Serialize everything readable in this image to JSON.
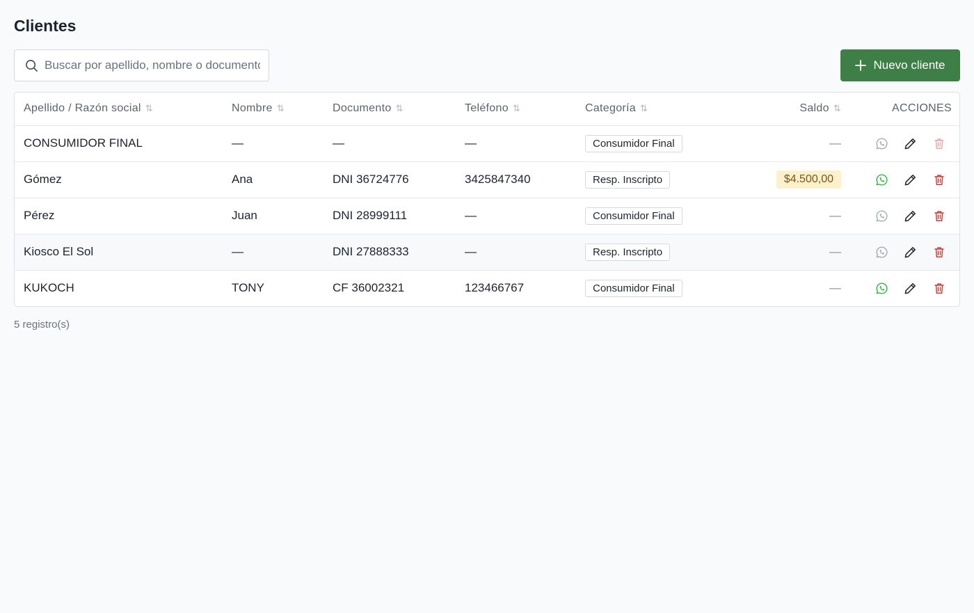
{
  "page": {
    "title": "Clientes"
  },
  "search": {
    "placeholder": "Buscar por apellido, nombre o documento",
    "value": ""
  },
  "new_button": {
    "label": "Nuevo cliente"
  },
  "table": {
    "headers": {
      "apellido": "Apellido / Razón social",
      "nombre": "Nombre",
      "documento": "Documento",
      "telefono": "Teléfono",
      "categoria": "Categoría",
      "saldo": "Saldo",
      "acciones": "ACCIONES"
    },
    "sort_glyph": "⇅",
    "rows": [
      {
        "apellido": "CONSUMIDOR FINAL",
        "nombre": "—",
        "documento": "—",
        "telefono": "—",
        "categoria": "Consumidor Final",
        "saldo": "—"
      },
      {
        "apellido": "Gómez",
        "nombre": "Ana",
        "documento": "DNI 36724776",
        "telefono": "3425847340",
        "categoria": "Resp. Inscripto",
        "saldo": "$4.500,00"
      },
      {
        "apellido": "Pérez",
        "nombre": "Juan",
        "documento": "DNI 28999111",
        "telefono": "—",
        "categoria": "Consumidor Final",
        "saldo": "—"
      },
      {
        "apellido": "Kiosco El Sol",
        "nombre": "—",
        "documento": "DNI 27888333",
        "telefono": "—",
        "categoria": "Resp. Inscripto",
        "saldo": "—"
      },
      {
        "apellido": "KUKOCH",
        "nombre": "TONY",
        "documento": "CF 36002321",
        "telefono": "123466767",
        "categoria": "Consumidor Final",
        "saldo": "—"
      }
    ]
  },
  "footer": {
    "count": "5 registro(s)"
  },
  "icons": {
    "search": "search-icon",
    "plus": "plus-icon",
    "whatsapp": "whatsapp-icon",
    "edit": "pencil-icon",
    "delete": "trash-icon"
  },
  "colors": {
    "primary_button": "#3d7f47",
    "whatsapp_active": "#3bb54a",
    "whatsapp_disabled": "#a7adb4",
    "delete": "#c73a36",
    "delete_disabled": "#eaa7a5",
    "saldo_badge_bg": "#fdf0cc",
    "saldo_badge_text": "#7a5714"
  }
}
